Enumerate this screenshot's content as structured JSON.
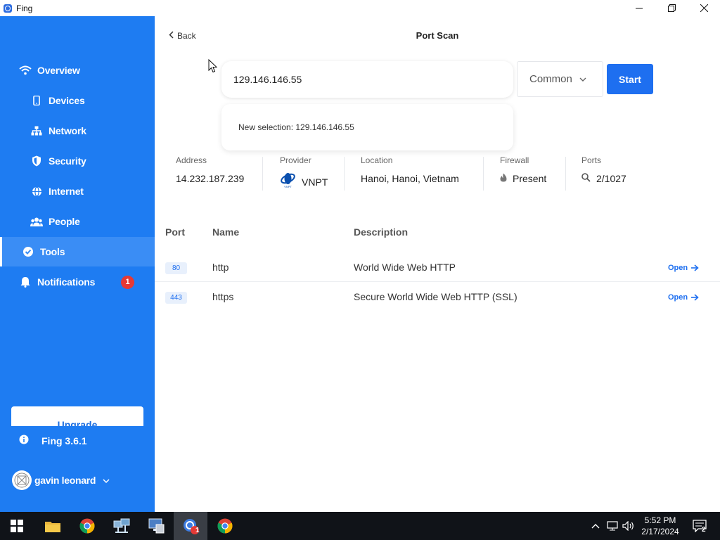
{
  "window": {
    "title": "Fing"
  },
  "sidebar": {
    "items": [
      {
        "label": "Overview"
      },
      {
        "label": "Devices"
      },
      {
        "label": "Network"
      },
      {
        "label": "Security"
      },
      {
        "label": "Internet"
      },
      {
        "label": "People"
      },
      {
        "label": "Tools"
      },
      {
        "label": "Notifications",
        "badge": "1"
      }
    ],
    "upgrade_label": "Upgrade",
    "version_label": "Fing 3.6.1",
    "user_name": "gavin leonard"
  },
  "header": {
    "back_label": "Back",
    "title": "Port Scan"
  },
  "scan": {
    "address_value": "129.146.146.55",
    "mode": "Common",
    "start_label": "Start",
    "suggestion": "New selection: 129.146.146.55"
  },
  "info": {
    "address_label": "Address",
    "address_value": "14.232.187.239",
    "provider_label": "Provider",
    "provider_value": "VNPT",
    "location_label": "Location",
    "location_value": "Hanoi, Hanoi, Vietnam",
    "firewall_label": "Firewall",
    "firewall_value": "Present",
    "ports_label": "Ports",
    "ports_value": "2/1027"
  },
  "table": {
    "headers": {
      "port": "Port",
      "name": "Name",
      "description": "Description"
    },
    "rows": [
      {
        "port": "80",
        "name": "http",
        "description": "World Wide Web HTTP",
        "status": "Open"
      },
      {
        "port": "443",
        "name": "https",
        "description": "Secure World Wide Web HTTP (SSL)",
        "status": "Open"
      }
    ]
  },
  "taskbar": {
    "time": "5:52 PM",
    "date": "2/17/2024",
    "fing_badge": "1",
    "notification_count": "2"
  },
  "colors": {
    "sidebar": "#1e7cf2",
    "accent": "#1e6ff0",
    "badge": "#e53935"
  }
}
